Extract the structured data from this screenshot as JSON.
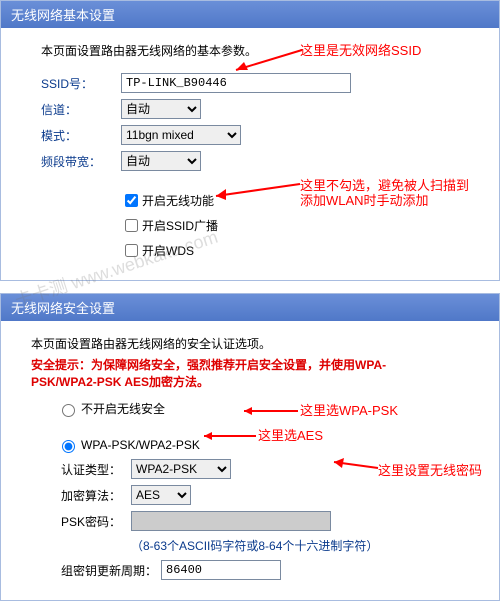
{
  "basic": {
    "header": "无线网络基本设置",
    "intro": "本页面设置路由器无线网络的基本参数。",
    "ssid_label": "SSID号：",
    "ssid_value": "TP-LINK_B90446",
    "channel_label": "信道：",
    "channel_value": "自动",
    "mode_label": "模式：",
    "mode_value": "11bgn mixed",
    "bandwidth_label": "频段带宽：",
    "bandwidth_value": "自动",
    "enable_wifi": "开启无线功能",
    "enable_ssid_broadcast": "开启SSID广播",
    "enable_wds": "开启WDS"
  },
  "security": {
    "header": "无线网络安全设置",
    "intro": "本页面设置路由器无线网络的安全认证选项。",
    "tip_label": "安全提示：",
    "tip_text1": "为保障网络安全，强烈推荐开启安全设置，并使用WPA-",
    "tip_text2": "PSK/WPA2-PSK AES加密方法。",
    "radio_none": "不开启无线安全",
    "radio_wpa": "WPA-PSK/WPA2-PSK",
    "auth_label": "认证类型：",
    "auth_value": "WPA2-PSK",
    "enc_label": "加密算法：",
    "enc_value": "AES",
    "psk_label": "PSK密码：",
    "psk_value": "",
    "psk_hint": "（8-63个ASCII码字符或8-64个十六进制字符）",
    "rekey_label": "组密钥更新周期：",
    "rekey_value": "86400"
  },
  "annotations": {
    "ssid": "这里是无效网络SSID",
    "broadcast1": "这里不勾选，避免被人扫描到",
    "broadcast2": "添加WLAN时手动添加",
    "wpa": "这里选WPA-PSK",
    "aes": "这里选AES",
    "pwd": "这里设置无线密码"
  },
  "watermark": "卡卡测 www.webkaka.com"
}
